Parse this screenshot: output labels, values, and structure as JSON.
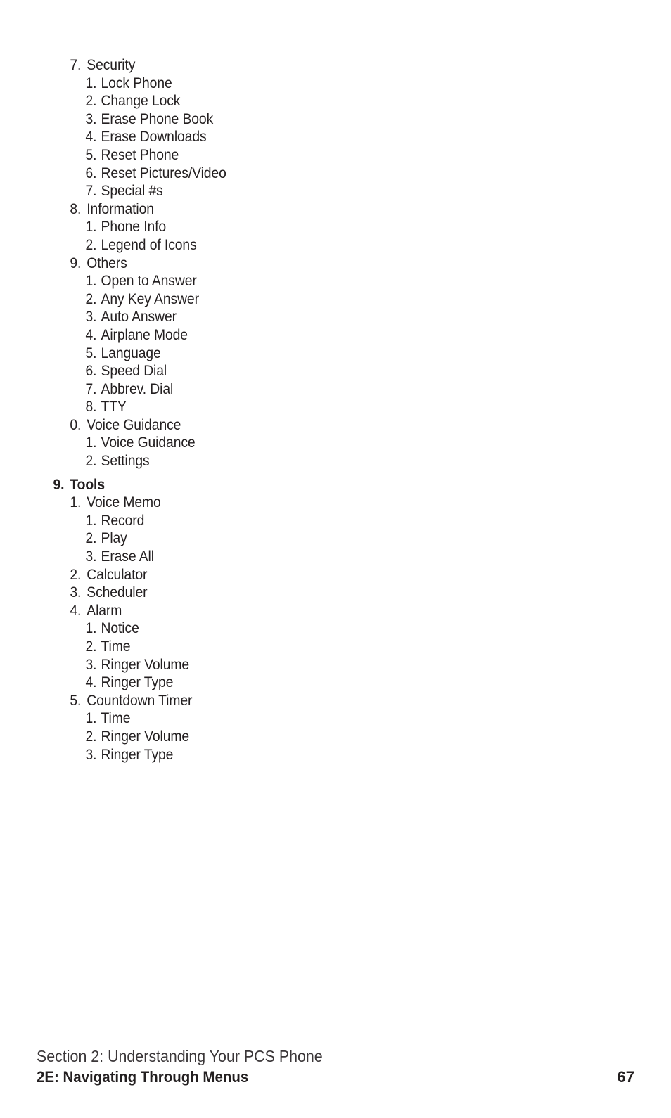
{
  "page": {
    "background_color": "#ffffff",
    "text_color": "#231f20"
  },
  "menu_tree": [
    {
      "level": 1,
      "marker": "7.",
      "label": "Security"
    },
    {
      "level": 2,
      "marker": "1.",
      "label": "Lock Phone"
    },
    {
      "level": 2,
      "marker": "2.",
      "label": "Change Lock"
    },
    {
      "level": 2,
      "marker": "3.",
      "label": "Erase Phone Book"
    },
    {
      "level": 2,
      "marker": "4.",
      "label": "Erase Downloads"
    },
    {
      "level": 2,
      "marker": "5.",
      "label": "Reset Phone"
    },
    {
      "level": 2,
      "marker": "6.",
      "label": "Reset Pictures/Video"
    },
    {
      "level": 2,
      "marker": "7.",
      "label": "Special #s"
    },
    {
      "level": 1,
      "marker": "8.",
      "label": "Information"
    },
    {
      "level": 2,
      "marker": "1.",
      "label": "Phone Info"
    },
    {
      "level": 2,
      "marker": "2.",
      "label": "Legend of Icons"
    },
    {
      "level": 1,
      "marker": "9.",
      "label": "Others"
    },
    {
      "level": 2,
      "marker": "1.",
      "label": "Open to Answer"
    },
    {
      "level": 2,
      "marker": "2.",
      "label": "Any Key Answer"
    },
    {
      "level": 2,
      "marker": "3.",
      "label": "Auto Answer"
    },
    {
      "level": 2,
      "marker": "4.",
      "label": "Airplane Mode"
    },
    {
      "level": 2,
      "marker": "5.",
      "label": "Language"
    },
    {
      "level": 2,
      "marker": "6.",
      "label": "Speed Dial"
    },
    {
      "level": 2,
      "marker": "7.",
      "label": "Abbrev. Dial"
    },
    {
      "level": 2,
      "marker": "8.",
      "label": "TTY"
    },
    {
      "level": 1,
      "marker": "0.",
      "label": "Voice Guidance"
    },
    {
      "level": 2,
      "marker": "1.",
      "label": "Voice Guidance"
    },
    {
      "level": 2,
      "marker": "2.",
      "label": "Settings"
    },
    {
      "level": "section",
      "marker": "9.",
      "label": "Tools",
      "gap_before": true
    },
    {
      "level": 1,
      "marker": "1.",
      "label": "Voice Memo"
    },
    {
      "level": 2,
      "marker": "1.",
      "label": "Record"
    },
    {
      "level": 2,
      "marker": "2.",
      "label": "Play"
    },
    {
      "level": 2,
      "marker": "3.",
      "label": "Erase All"
    },
    {
      "level": 1,
      "marker": "2.",
      "label": "Calculator"
    },
    {
      "level": 1,
      "marker": "3.",
      "label": "Scheduler"
    },
    {
      "level": 1,
      "marker": "4.",
      "label": "Alarm"
    },
    {
      "level": 2,
      "marker": "1.",
      "label": "Notice"
    },
    {
      "level": 2,
      "marker": "2.",
      "label": "Time"
    },
    {
      "level": 2,
      "marker": "3.",
      "label": "Ringer Volume"
    },
    {
      "level": 2,
      "marker": "4.",
      "label": "Ringer Type"
    },
    {
      "level": 1,
      "marker": "5.",
      "label": "Countdown Timer"
    },
    {
      "level": 2,
      "marker": "1.",
      "label": "Time"
    },
    {
      "level": 2,
      "marker": "2.",
      "label": "Ringer Volume"
    },
    {
      "level": 2,
      "marker": "3.",
      "label": "Ringer Type"
    }
  ],
  "footer": {
    "section_line": "Section 2: Understanding Your PCS Phone",
    "chapter_line": "2E: Navigating Through Menus",
    "page_number": "67"
  }
}
